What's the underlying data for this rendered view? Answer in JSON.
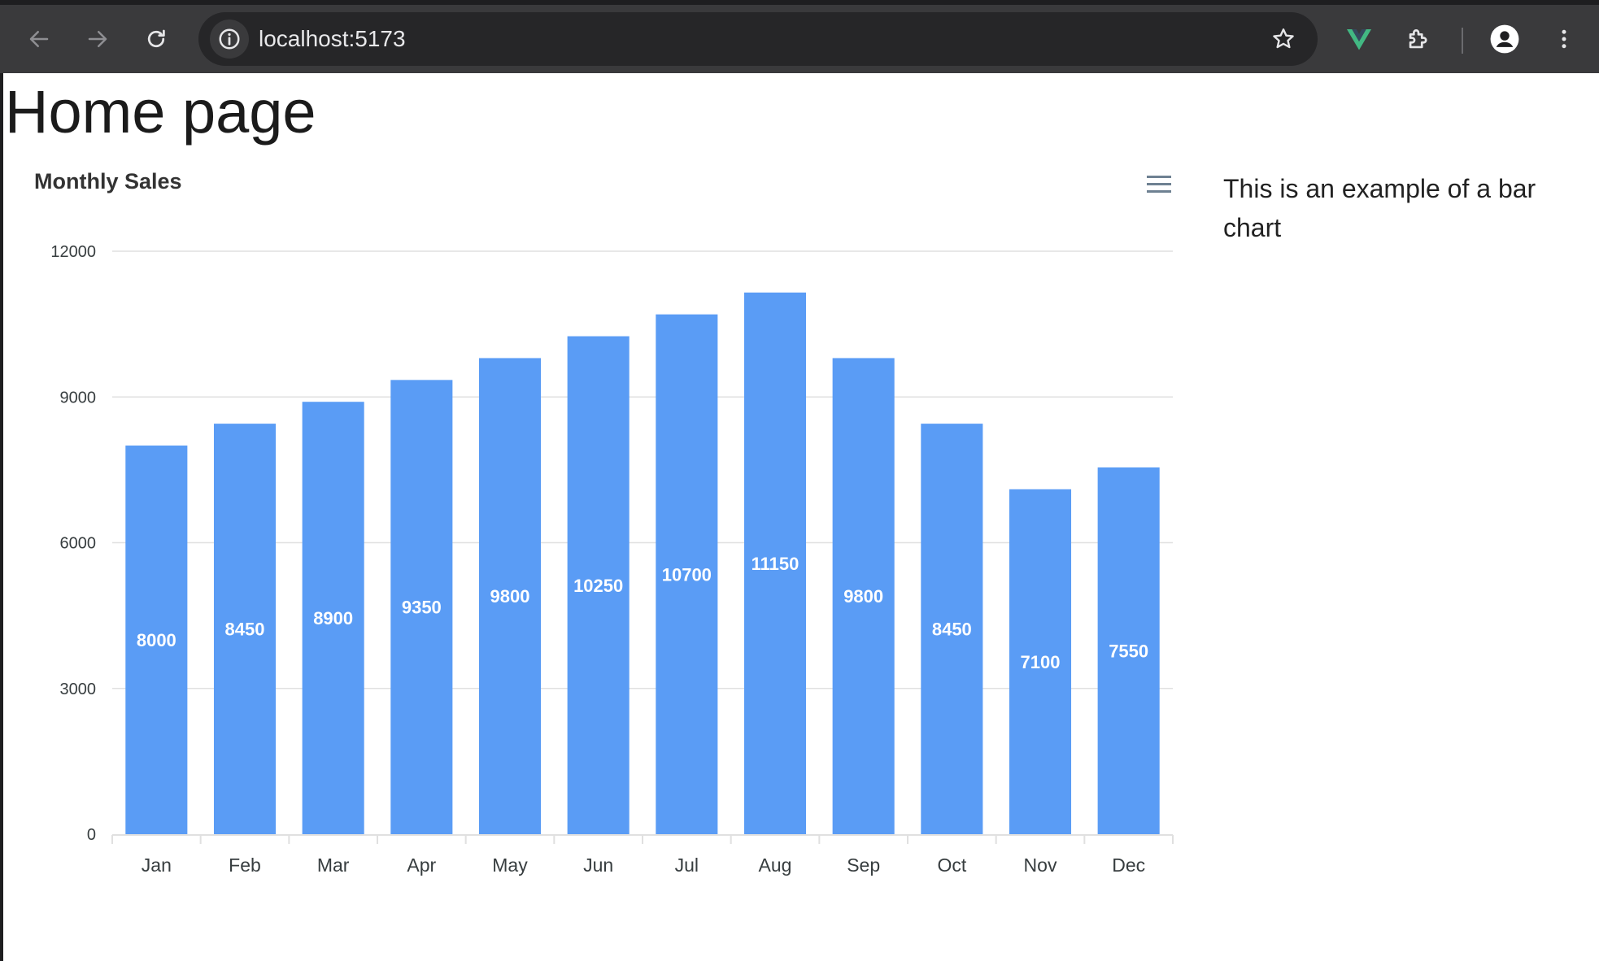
{
  "browser": {
    "url": "localhost:5173",
    "icons": {
      "back": "arrow-left-icon",
      "forward": "arrow-right-icon",
      "reload": "reload-icon",
      "site_info": "info-icon",
      "bookmark": "star-icon",
      "vue_extension": "vue-logo-icon",
      "extensions": "puzzle-icon",
      "profile": "person-icon",
      "menu": "kebab-icon"
    },
    "colors": {
      "vue_green": "#42b883"
    }
  },
  "page": {
    "title": "Home page",
    "description": "This is an example of a bar chart"
  },
  "chart_data": {
    "type": "bar",
    "title": "Monthly Sales",
    "categories": [
      "Jan",
      "Feb",
      "Mar",
      "Apr",
      "May",
      "Jun",
      "Jul",
      "Aug",
      "Sep",
      "Oct",
      "Nov",
      "Dec"
    ],
    "values": [
      8000,
      8450,
      8900,
      9350,
      9800,
      10250,
      10700,
      11150,
      9800,
      8450,
      7100,
      7550
    ],
    "ylim": [
      0,
      12000
    ],
    "yticks": [
      0,
      3000,
      6000,
      9000,
      12000
    ],
    "grid": true,
    "data_labels": true,
    "legend": "none",
    "bar_color": "#5a9cf5",
    "menu_icon": "hamburger-icon"
  }
}
